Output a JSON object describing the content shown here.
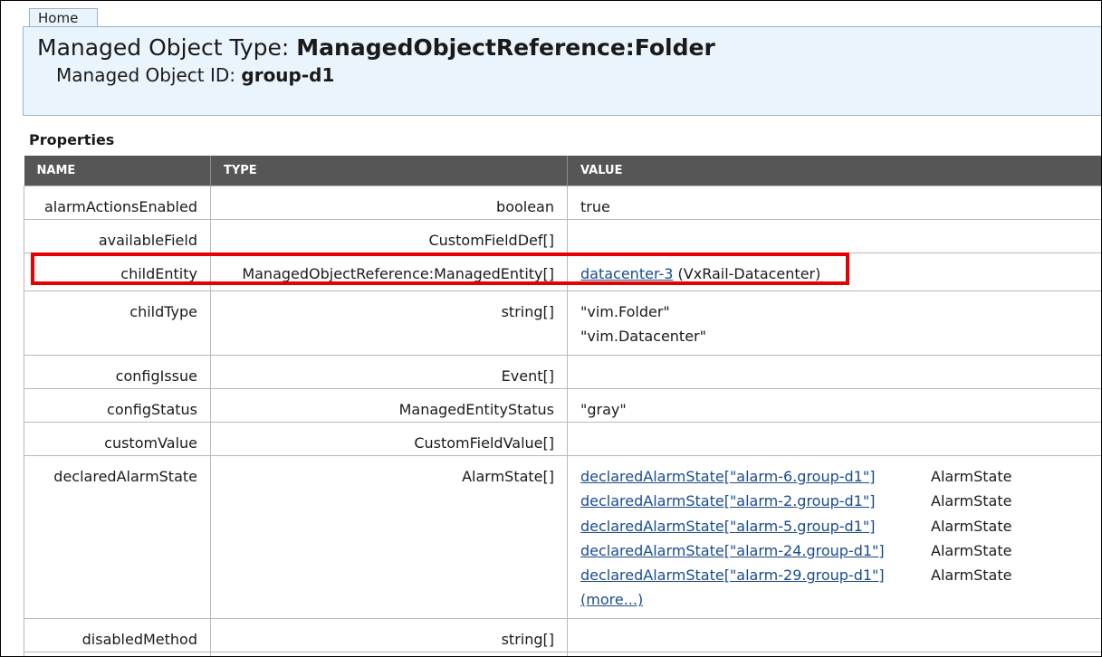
{
  "tab": {
    "home_label": "Home"
  },
  "header": {
    "type_label": "Managed Object Type:",
    "type_value": "ManagedObjectReference:Folder",
    "id_label": "Managed Object ID:",
    "id_value": "group-d1"
  },
  "properties": {
    "title": "Properties",
    "columns": [
      "NAME",
      "TYPE",
      "VALUE"
    ],
    "rows": [
      {
        "name": "alarmActionsEnabled",
        "type": "boolean",
        "values": [
          "true"
        ]
      },
      {
        "name": "availableField",
        "type": "CustomFieldDef[]",
        "values": []
      },
      {
        "name": "childEntity",
        "type": "ManagedObjectReference:ManagedEntity[]",
        "link": "datacenter-3",
        "suffix": " (VxRail-Datacenter)"
      },
      {
        "name": "childType",
        "type": "string[]",
        "values": [
          "\"vim.Folder\"",
          "\"vim.Datacenter\""
        ]
      },
      {
        "name": "configIssue",
        "type": "Event[]",
        "values": []
      },
      {
        "name": "configStatus",
        "type": "ManagedEntityStatus",
        "values": [
          "\"gray\""
        ]
      },
      {
        "name": "customValue",
        "type": "CustomFieldValue[]",
        "values": []
      },
      {
        "name": "declaredAlarmState",
        "type": "AlarmState[]",
        "alarms": [
          {
            "link": "declaredAlarmState[\"alarm-6.group-d1\"]",
            "type": "AlarmState"
          },
          {
            "link": "declaredAlarmState[\"alarm-2.group-d1\"]",
            "type": "AlarmState"
          },
          {
            "link": "declaredAlarmState[\"alarm-5.group-d1\"]",
            "type": "AlarmState"
          },
          {
            "link": "declaredAlarmState[\"alarm-24.group-d1\"]",
            "type": "AlarmState"
          },
          {
            "link": "declaredAlarmState[\"alarm-29.group-d1\"]",
            "type": "AlarmState"
          }
        ],
        "more": "(more...)"
      },
      {
        "name": "disabledMethod",
        "type": "string[]",
        "values": []
      }
    ]
  }
}
